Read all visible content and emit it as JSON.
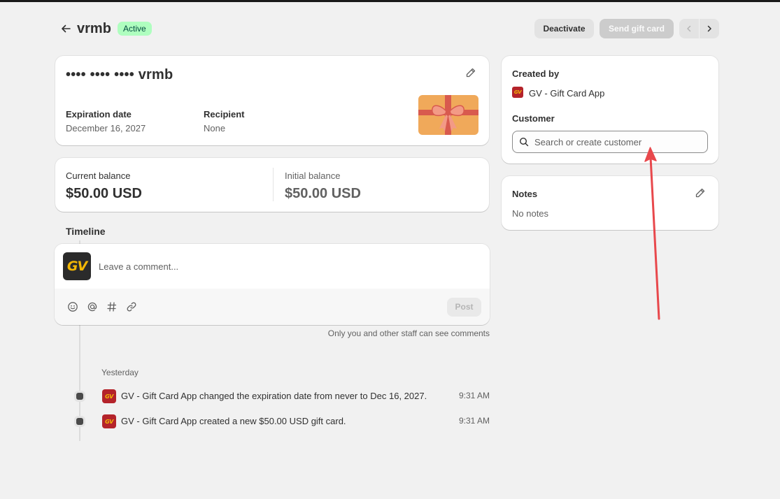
{
  "header": {
    "title": "vrmb",
    "status": "Active",
    "deactivate_label": "Deactivate",
    "send_label": "Send gift card"
  },
  "gift_card": {
    "masked_code": "•••• •••• •••• vrmb",
    "expiration_label": "Expiration date",
    "expiration_value": "December 16, 2027",
    "recipient_label": "Recipient",
    "recipient_value": "None"
  },
  "balance": {
    "current_label": "Current balance",
    "current_value": "$50.00 USD",
    "initial_label": "Initial balance",
    "initial_value": "$50.00 USD"
  },
  "timeline": {
    "title": "Timeline",
    "avatar_text": "GV",
    "comment_placeholder": "Leave a comment...",
    "post_label": "Post",
    "staff_note": "Only you and other staff can see comments",
    "day_label": "Yesterday",
    "events": [
      {
        "text": "GV - Gift Card App changed the expiration date from never to Dec 16, 2027.",
        "time": "9:31 AM",
        "icon_text": "GV"
      },
      {
        "text": "GV - Gift Card App created a new $50.00 USD gift card.",
        "time": "9:31 AM",
        "icon_text": "GV"
      }
    ]
  },
  "sidebar": {
    "created_by_label": "Created by",
    "creator_name": "GV - Gift Card App",
    "creator_icon_text": "GV",
    "customer_label": "Customer",
    "customer_placeholder": "Search or create customer",
    "notes_label": "Notes",
    "notes_value": "No notes"
  },
  "colors": {
    "background": "#f1f1f1",
    "badge_bg": "#affebf",
    "badge_text": "#014b40",
    "annotation_arrow": "#e8484c",
    "gift_card_orange": "#f0a95a",
    "gift_ribbon": "#d85a4e"
  }
}
